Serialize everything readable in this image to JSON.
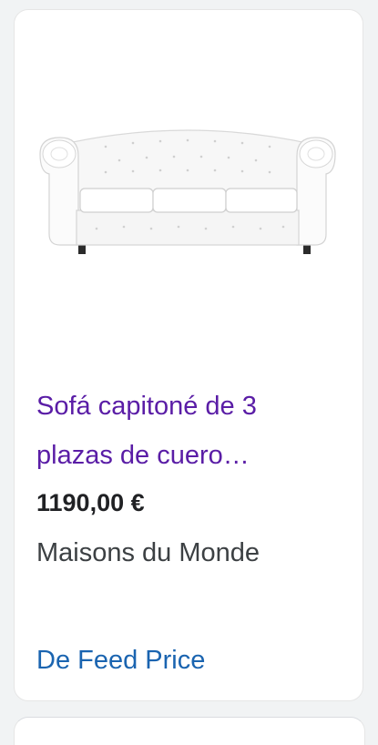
{
  "product": {
    "title": "Sofá capitoné de 3 plazas de cuero…",
    "price": "1190,00 €",
    "merchant": "Maisons du Monde",
    "source_link": "De Feed Price",
    "image_icon": "white-chesterfield-sofa-image"
  },
  "colors": {
    "title": "#5a1da6",
    "link": "#1a64b0",
    "price": "#202124",
    "merchant": "#3c4043"
  }
}
